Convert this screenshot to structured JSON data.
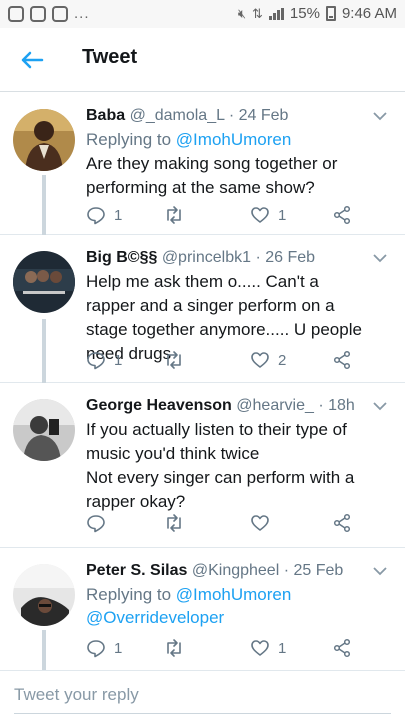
{
  "statusbar": {
    "dots": "...",
    "battery": "15%",
    "time": "9:46 AM"
  },
  "appbar": {
    "title": "Tweet"
  },
  "replies": [
    {
      "name": "Baba",
      "handle": "@_damola_L",
      "date": "· 24 Feb",
      "replying_prefix": "Replying to",
      "replying_to": [
        "@ImohUmoren"
      ],
      "text": "Are they making song together or performing at the same show?",
      "reply_count": "1",
      "retweet_count": "",
      "like_count": "1"
    },
    {
      "name": "Big B©§§",
      "handle": "@princelbk1",
      "date": "· 26 Feb",
      "text": "Help me ask them o..... Can't a rapper and a singer perform on a stage together anymore..... U people need drugs",
      "reply_count": "1",
      "retweet_count": "",
      "like_count": "2"
    },
    {
      "name": "George Heavenson",
      "handle": "@hearvie_",
      "date": "· 18h",
      "text_lines": [
        "If you actually listen to their type of",
        "music you'd think twice",
        "Not every singer can perform with a",
        "rapper okay?"
      ],
      "reply_count": "",
      "retweet_count": "",
      "like_count": ""
    },
    {
      "name": "Peter S. Silas",
      "handle": "@Kingpheel",
      "date": "· 25 Feb",
      "replying_prefix": "Replying to",
      "replying_to": [
        "@ImohUmoren",
        "@Overrideveloper"
      ],
      "reply_count": "1",
      "retweet_count": "",
      "like_count": "1"
    }
  ],
  "compose": {
    "placeholder": "Tweet your reply"
  },
  "colors": {
    "accent": "#1da1f2",
    "muted": "#657786",
    "thread_line": "#ccd6dd"
  }
}
